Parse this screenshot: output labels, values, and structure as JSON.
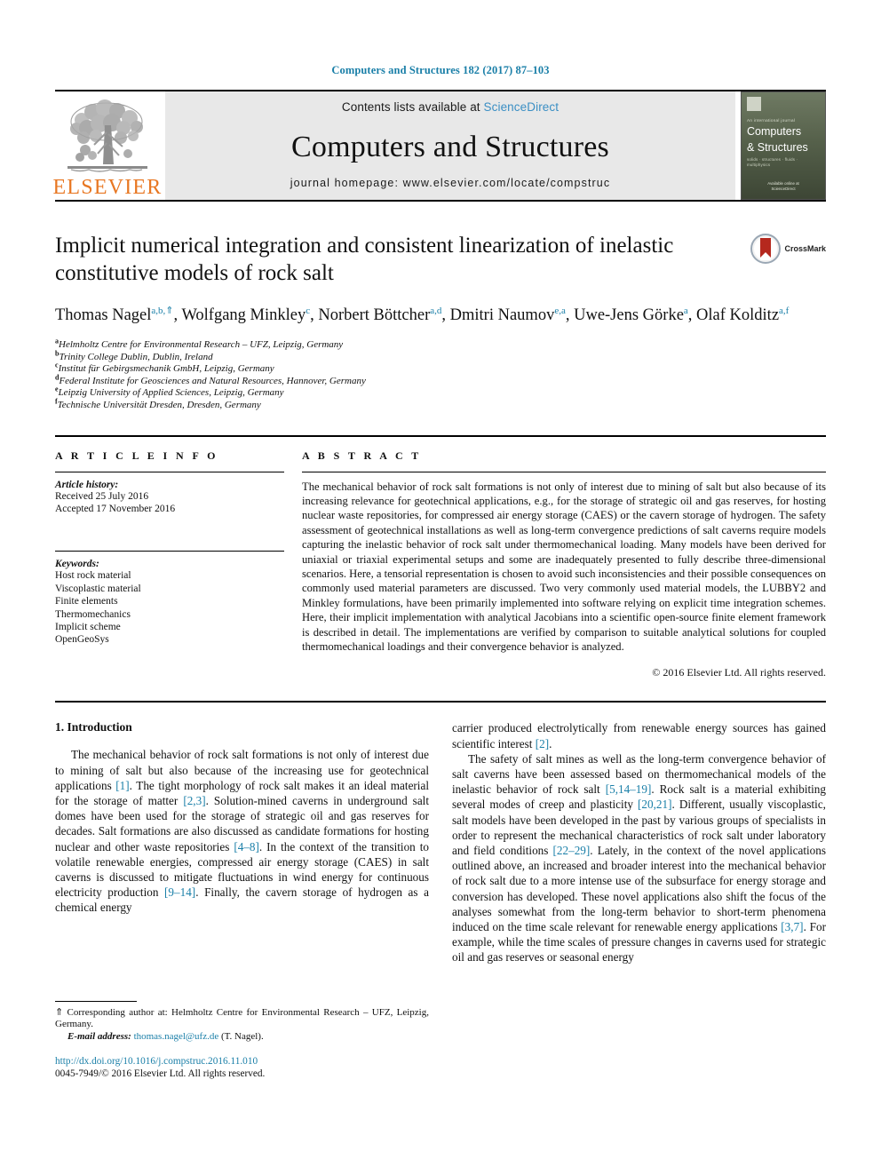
{
  "running_head": "Computers and Structures 182 (2017) 87–103",
  "masthead": {
    "publisher_name": "ELSEVIER",
    "contents_prefix": "Contents lists available at ",
    "contents_link": "ScienceDirect",
    "journal_name": "Computers and Structures",
    "homepage": "journal homepage: www.elsevier.com/locate/compstruc",
    "cover": {
      "issn_line": "An international journal",
      "title_line1": "Computers",
      "title_line2": "& Structures",
      "subtitle": "solids · structures · fluids · multiphysics",
      "footer_line1": "Available online at",
      "footer_line2": "ScienceDirect"
    }
  },
  "article": {
    "title": "Implicit numerical integration and consistent linearization of inelastic constitutive models of rock salt",
    "crossmark_label": "CrossMark",
    "authors": [
      {
        "name": "Thomas Nagel",
        "sup": "a,b,",
        "star": "⇑",
        "sep": ", "
      },
      {
        "name": "Wolfgang Minkley",
        "sup": "c",
        "star": "",
        "sep": ", "
      },
      {
        "name": "Norbert Böttcher",
        "sup": "a,d",
        "star": "",
        "sep": ", "
      },
      {
        "name": "Dmitri Naumov",
        "sup": "e,a",
        "star": "",
        "sep": ", "
      },
      {
        "name": "Uwe-Jens Görke",
        "sup": "a",
        "star": "",
        "sep": ", "
      },
      {
        "name": "Olaf Kolditz",
        "sup": "a,f",
        "star": "",
        "sep": ""
      }
    ],
    "affiliations": [
      {
        "key": "a",
        "text": "Helmholtz Centre for Environmental Research – UFZ, Leipzig, Germany"
      },
      {
        "key": "b",
        "text": "Trinity College Dublin, Dublin, Ireland"
      },
      {
        "key": "c",
        "text": "Institut für Gebirgsmechanik GmbH, Leipzig, Germany"
      },
      {
        "key": "d",
        "text": "Federal Institute for Geosciences and Natural Resources, Hannover, Germany"
      },
      {
        "key": "e",
        "text": "Leipzig University of Applied Sciences, Leipzig, Germany"
      },
      {
        "key": "f",
        "text": "Technische Universität Dresden, Dresden, Germany"
      }
    ]
  },
  "article_info": {
    "heading": "A R T I C L E   I N F O",
    "history_label": "Article history:",
    "history": [
      "Received 25 July 2016",
      "Accepted 17 November 2016"
    ],
    "keywords_label": "Keywords:",
    "keywords": [
      "Host rock material",
      "Viscoplastic material",
      "Finite elements",
      "Thermomechanics",
      "Implicit scheme",
      "OpenGeoSys"
    ]
  },
  "abstract": {
    "heading": "A B S T R A C T",
    "text": "The mechanical behavior of rock salt formations is not only of interest due to mining of salt but also because of its increasing relevance for geotechnical applications, e.g., for the storage of strategic oil and gas reserves, for hosting nuclear waste repositories, for compressed air energy storage (CAES) or the cavern storage of hydrogen. The safety assessment of geotechnical installations as well as long-term convergence predictions of salt caverns require models capturing the inelastic behavior of rock salt under thermomechanical loading. Many models have been derived for uniaxial or triaxial experimental setups and some are inadequately presented to fully describe three-dimensional scenarios. Here, a tensorial representation is chosen to avoid such inconsistencies and their possible consequences on commonly used material parameters are discussed. Two very commonly used material models, the LUBBY2 and Minkley formulations, have been primarily implemented into software relying on explicit time integration schemes. Here, their implicit implementation with analytical Jacobians into a scientific open-source finite element framework is described in detail. The implementations are verified by comparison to suitable analytical solutions for coupled thermomechanical loadings and their convergence behavior is analyzed.",
    "copyright": "© 2016 Elsevier Ltd. All rights reserved."
  },
  "body": {
    "section_number_title": "1. Introduction",
    "left_paragraph_1_a": "The mechanical behavior of rock salt formations is not only of interest due to mining of salt but also because of the increasing use for geotechnical applications ",
    "left_ref_1": "[1]",
    "left_paragraph_1_b": ". The tight morphology of rock salt makes it an ideal material for the storage of matter ",
    "left_ref_2": "[2,3]",
    "left_paragraph_1_c": ". Solution-mined caverns in underground salt domes have been used for the storage of strategic oil and gas reserves for decades. Salt formations are also discussed as candidate formations for hosting nuclear and other waste repositories ",
    "left_ref_3": "[4–8]",
    "left_paragraph_1_d": ". In the context of the transition to volatile renewable energies, compressed air energy storage (CAES) in salt caverns is discussed to mitigate fluctuations in wind energy for continuous electricity production ",
    "left_ref_4": "[9–14]",
    "left_paragraph_1_e": ". Finally, the cavern storage of hydrogen as a chemical energy",
    "right_paragraph_1_a": "carrier produced electrolytically from renewable energy sources has gained scientific interest ",
    "right_ref_1": "[2]",
    "right_paragraph_1_b": ".",
    "right_paragraph_2_a": "The safety of salt mines as well as the long-term convergence behavior of salt caverns have been assessed based on thermomechanical models of the inelastic behavior of rock salt ",
    "right_ref_2": "[5,14–19]",
    "right_paragraph_2_b": ". Rock salt is a material exhibiting several modes of creep and plasticity ",
    "right_ref_3": "[20,21]",
    "right_paragraph_2_c": ". Different, usually viscoplastic, salt models have been developed in the past by various groups of specialists in order to represent the mechanical characteristics of rock salt under laboratory and field conditions ",
    "right_ref_4": "[22–29]",
    "right_paragraph_2_d": ". Lately, in the context of the novel applications outlined above, an increased and broader interest into the mechanical behavior of rock salt due to a more intense use of the subsurface for energy storage and conversion has developed. These novel applications also shift the focus of the analyses somewhat from the long-term behavior to short-term phenomena induced on the time scale relevant for renewable energy applications ",
    "right_ref_5": "[3,7]",
    "right_paragraph_2_e": ". For example, while the time scales of pressure changes in caverns used for strategic oil and gas reserves or seasonal energy"
  },
  "footer": {
    "corresponding_marker": "⇑",
    "corresponding_text": " Corresponding author at: Helmholtz Centre for Environmental Research – UFZ, Leipzig, Germany.",
    "email_label": "E-mail address:",
    "email": "thomas.nagel@ufz.de",
    "email_suffix": " (T. Nagel).",
    "doi": "http://dx.doi.org/10.1016/j.compstruc.2016.11.010",
    "issn": "0045-7949/© 2016 Elsevier Ltd. All rights reserved."
  },
  "colors": {
    "link_blue": "#1a7fa8",
    "sciencedirect_blue": "#3b8fc4",
    "elsevier_orange": "#e87722",
    "masthead_gray": "#e8e8e8"
  }
}
